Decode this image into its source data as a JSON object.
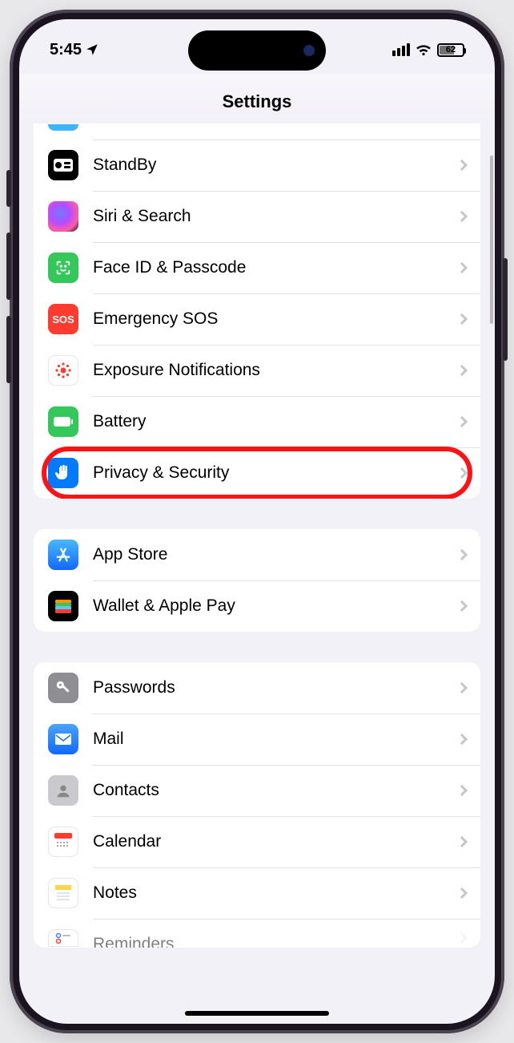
{
  "status": {
    "time": "5:45",
    "battery": "62"
  },
  "title": "Settings",
  "sections": [
    {
      "rows": [
        {
          "id": "standby",
          "label": "StandBy"
        },
        {
          "id": "siri",
          "label": "Siri & Search"
        },
        {
          "id": "faceid",
          "label": "Face ID & Passcode"
        },
        {
          "id": "sos",
          "label": "Emergency SOS"
        },
        {
          "id": "exposure",
          "label": "Exposure Notifications"
        },
        {
          "id": "battery",
          "label": "Battery"
        },
        {
          "id": "privacy",
          "label": "Privacy & Security",
          "highlighted": true
        }
      ]
    },
    {
      "rows": [
        {
          "id": "appstore",
          "label": "App Store"
        },
        {
          "id": "wallet",
          "label": "Wallet & Apple Pay"
        }
      ]
    },
    {
      "rows": [
        {
          "id": "passwords",
          "label": "Passwords"
        },
        {
          "id": "mail",
          "label": "Mail"
        },
        {
          "id": "contacts",
          "label": "Contacts"
        },
        {
          "id": "calendar",
          "label": "Calendar"
        },
        {
          "id": "notes",
          "label": "Notes"
        },
        {
          "id": "reminders",
          "label": "Reminders"
        }
      ]
    }
  ]
}
